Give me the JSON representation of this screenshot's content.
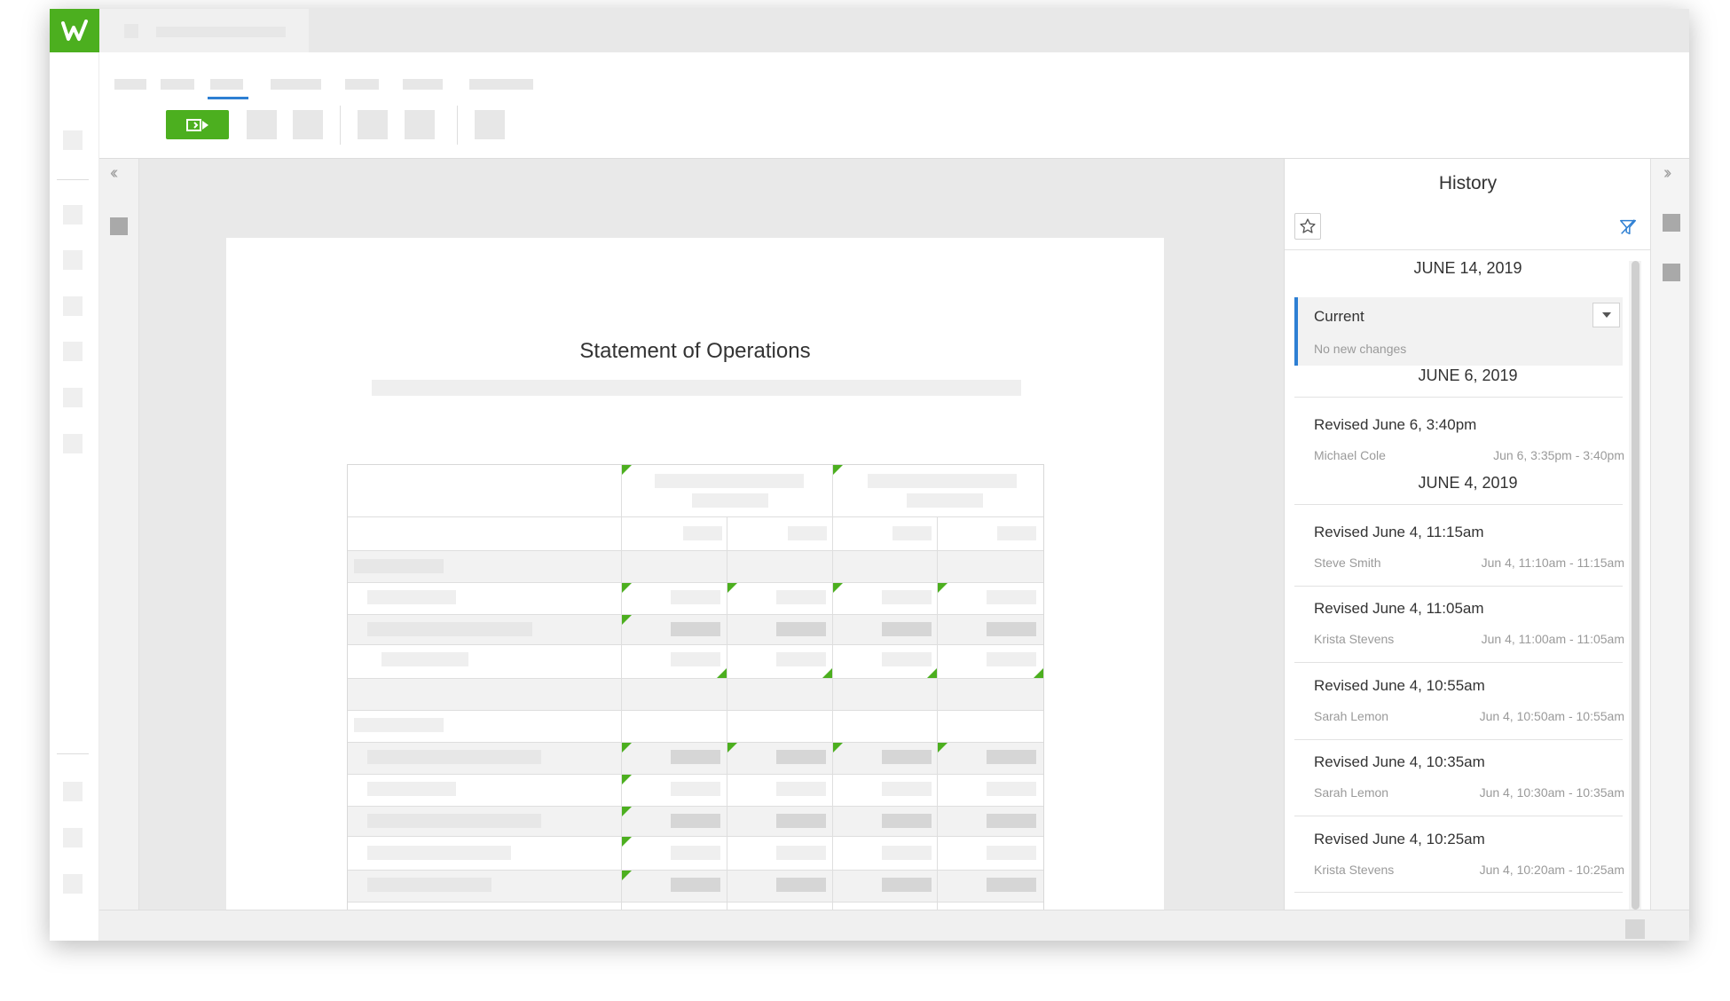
{
  "app": {
    "logo_letter": "w",
    "brand_color": "#4caf1f",
    "accent_color": "#2d7fd3"
  },
  "toolbar": {
    "present_icon": "present-icon",
    "active_tab_index": 2
  },
  "document": {
    "title": "Statement of Operations"
  },
  "history": {
    "title": "History",
    "star_icon": "star-icon",
    "filter_icon": "filter-icon",
    "groups": [
      {
        "date": "JUNE 14, 2019"
      },
      {
        "date": "JUNE 6, 2019"
      },
      {
        "date": "JUNE 4, 2019"
      }
    ],
    "current": {
      "label": "Current",
      "subtitle": "No new changes"
    },
    "revisions": [
      {
        "title": "Revised June 6, 3:40pm",
        "user": "Michael Cole",
        "range": "Jun 6, 3:35pm - 3:40pm"
      },
      {
        "title": "Revised June 4, 11:15am",
        "user": "Steve Smith",
        "range": "Jun 4, 11:10am - 11:15am"
      },
      {
        "title": "Revised June 4, 11:05am",
        "user": "Krista Stevens",
        "range": "Jun 4, 11:00am - 11:05am"
      },
      {
        "title": "Revised June 4, 10:55am",
        "user": "Sarah Lemon",
        "range": "Jun 4, 10:50am - 10:55am"
      },
      {
        "title": "Revised June 4, 10:35am",
        "user": "Sarah Lemon",
        "range": "Jun 4, 10:30am - 10:35am"
      },
      {
        "title": "Revised June 4, 10:25am",
        "user": "Krista Stevens",
        "range": "Jun 4, 10:20am - 10:25am"
      }
    ]
  }
}
